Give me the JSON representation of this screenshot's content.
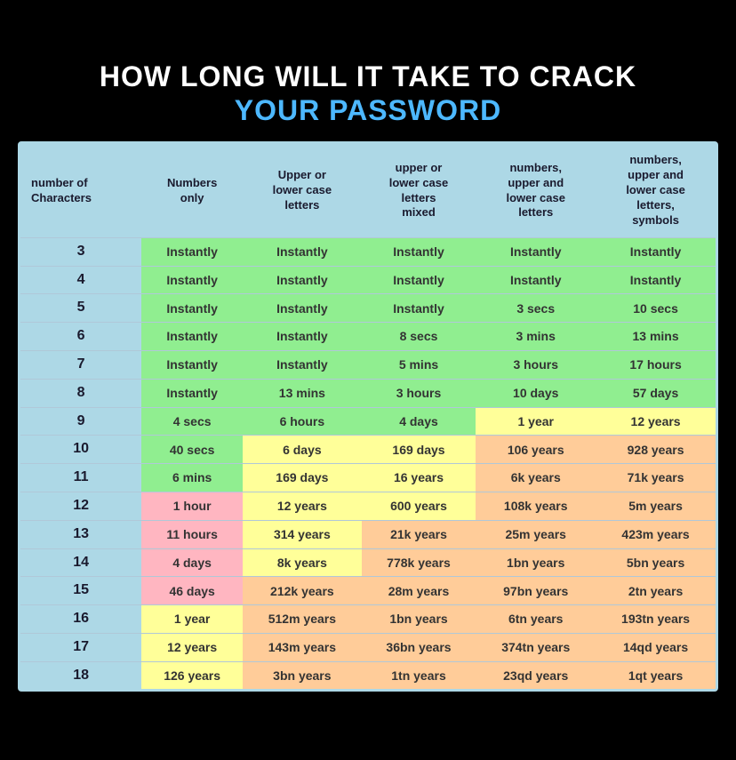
{
  "title": {
    "line1": "HOW LONG WILL IT TAKE TO CRACK",
    "line2": "YOUR PASSWORD"
  },
  "headers": [
    "number of\nCharacters",
    "Numbers\nonly",
    "Upper or\nlower case\nletters",
    "upper or\nlower case\nletters\nmixed",
    "numbers,\nupper and\nlower case\nletters",
    "numbers,\nupper and\nlower case\nletters,\nsymbols"
  ],
  "rows": [
    {
      "chars": "3",
      "num": "Instantly",
      "upper": "Instantly",
      "mixed": "Instantly",
      "numUpper": "Instantly",
      "all": "Instantly",
      "color": "green"
    },
    {
      "chars": "4",
      "num": "Instantly",
      "upper": "Instantly",
      "mixed": "Instantly",
      "numUpper": "Instantly",
      "all": "Instantly",
      "color": "green"
    },
    {
      "chars": "5",
      "num": "Instantly",
      "upper": "Instantly",
      "mixed": "Instantly",
      "numUpper": "3 secs",
      "all": "10 secs",
      "color": "green"
    },
    {
      "chars": "6",
      "num": "Instantly",
      "upper": "Instantly",
      "mixed": "8 secs",
      "numUpper": "3 mins",
      "all": "13 mins",
      "color": "green"
    },
    {
      "chars": "7",
      "num": "Instantly",
      "upper": "Instantly",
      "mixed": "5 mins",
      "numUpper": "3 hours",
      "all": "17 hours",
      "color": "green"
    },
    {
      "chars": "8",
      "num": "Instantly",
      "upper": "13 mins",
      "mixed": "3 hours",
      "numUpper": "10 days",
      "all": "57 days",
      "color": "green"
    },
    {
      "chars": "9",
      "num": "4 secs",
      "upper": "6 hours",
      "mixed": "4 days",
      "numUpper": "1 year",
      "all": "12 years",
      "color": "mixed9"
    },
    {
      "chars": "10",
      "num": "40 secs",
      "upper": "6 days",
      "mixed": "169 days",
      "numUpper": "106 years",
      "all": "928 years",
      "color": "mixed10"
    },
    {
      "chars": "11",
      "num": "6 mins",
      "upper": "169 days",
      "mixed": "16 years",
      "numUpper": "6k years",
      "all": "71k years",
      "color": "yellow"
    },
    {
      "chars": "12",
      "num": "1 hour",
      "upper": "12 years",
      "mixed": "600 years",
      "numUpper": "108k years",
      "all": "5m years",
      "color": "yellow"
    },
    {
      "chars": "13",
      "num": "11 hours",
      "upper": "314 years",
      "mixed": "21k years",
      "numUpper": "25m years",
      "all": "423m years",
      "color": "yellow"
    },
    {
      "chars": "14",
      "num": "4 days",
      "upper": "8k years",
      "mixed": "778k years",
      "numUpper": "1bn years",
      "all": "5bn years",
      "color": "yellow"
    },
    {
      "chars": "15",
      "num": "46 days",
      "upper": "212k years",
      "mixed": "28m years",
      "numUpper": "97bn years",
      "all": "2tn years",
      "color": "orange"
    },
    {
      "chars": "16",
      "num": "1 year",
      "upper": "512m years",
      "mixed": "1bn years",
      "numUpper": "6tn years",
      "all": "193tn years",
      "color": "orange"
    },
    {
      "chars": "17",
      "num": "12 years",
      "upper": "143m years",
      "mixed": "36bn years",
      "numUpper": "374tn years",
      "all": "14qd years",
      "color": "orange"
    },
    {
      "chars": "18",
      "num": "126 years",
      "upper": "3bn years",
      "mixed": "1tn years",
      "numUpper": "23qd years",
      "all": "1qt years",
      "color": "orange"
    }
  ]
}
